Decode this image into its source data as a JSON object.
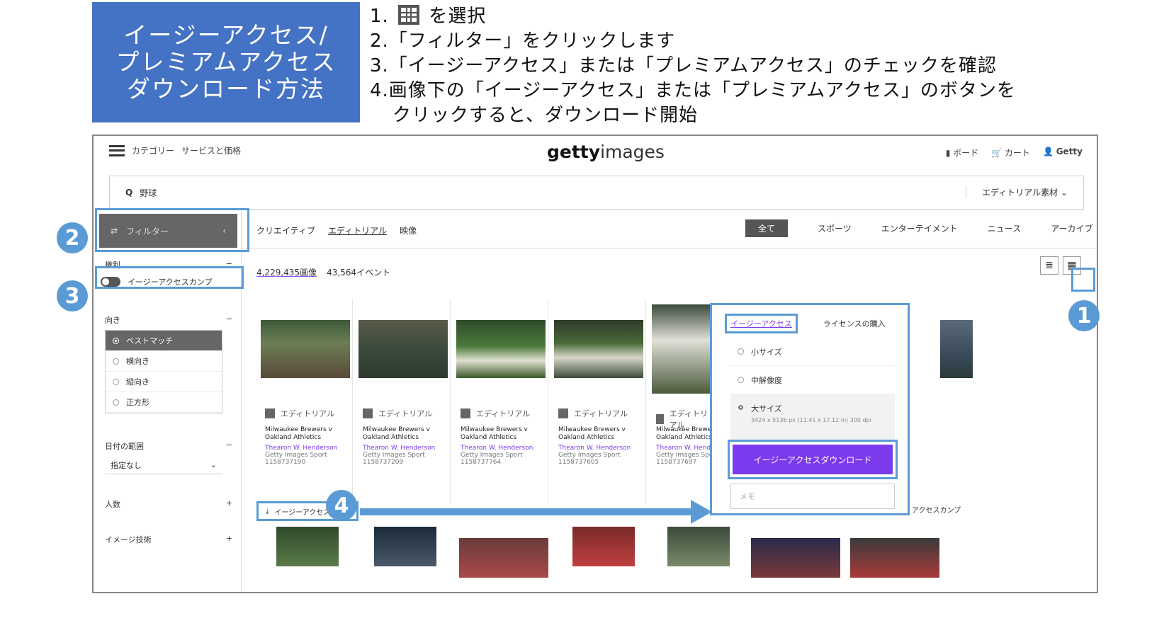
{
  "title_box": {
    "line1": "イージーアクセス/",
    "line2": "プレミアムアクセス",
    "line3": "ダウンロード方法"
  },
  "steps": {
    "s1_prefix": "1.",
    "s1_suffix": "を選択",
    "s2": "2.「フィルター」をクリックします",
    "s3": "3.「イージーアクセス」または「プレミアムアクセス」のチェックを確認",
    "s4": "4.画像下の「イージーアクセス」または「プレミアムアクセス」のボタンを",
    "s4b": "クリックすると、ダウンロード開始"
  },
  "app": {
    "topbar": {
      "categories": "カテゴリー",
      "services": "サービスと価格",
      "logo_bold": "getty",
      "logo_rest": "images",
      "boards": "ボード",
      "cart": "カート",
      "user": "Getty"
    },
    "search": {
      "value": "野球",
      "scope": "エディトリアル素材"
    },
    "filter_button": "フィルター",
    "nav_tabs": [
      "クリエイティブ",
      "エディトリアル",
      "映像"
    ],
    "category_tabs": [
      "全て",
      "スポーツ",
      "エンターテイメント",
      "ニュース",
      "アーカイブ"
    ],
    "sidebar": {
      "license_label": "権利",
      "toggle_label": "イージーアクセスカンプ",
      "orientation_label": "向き",
      "orientation_options": [
        "ベストマッチ",
        "横向き",
        "縦向き",
        "正方形"
      ],
      "date_label": "日付の範囲",
      "date_value": "指定なし",
      "people_label": "人数",
      "image_tech_label": "イメージ技術"
    },
    "results": {
      "images": "4,229,435画像",
      "events": "43,564イベント"
    },
    "cards": [
      {
        "badge": "エディトリアル",
        "title": "Milwaukee Brewers v Oakland Athletics",
        "credit": "Thearon W. Henderson",
        "source": "Getty Images Sport",
        "id": "1158737190"
      },
      {
        "badge": "エディトリアル",
        "title": "Milwaukee Brewers v Oakland Athletics",
        "credit": "Thearon W. Henderson",
        "source": "Getty Images Sport",
        "id": "1158737209"
      },
      {
        "badge": "エディトリアル",
        "title": "Milwaukee Brewers v Oakland Athletics",
        "credit": "Thearon W. Henderson",
        "source": "Getty Images Sport",
        "id": "1158737764"
      },
      {
        "badge": "エディトリアル",
        "title": "Milwaukee Brewers v Oakland Athletics",
        "credit": "Thearon W. Henderson",
        "source": "Getty Images Sport",
        "id": "1158737605"
      },
      {
        "badge": "エディトリアル",
        "title": "Milwaukee Brewers v Oakland Athletics",
        "credit": "Thearon W. Henderson",
        "source": "Getty Images Sport",
        "id": "1158737697"
      }
    ],
    "popup": {
      "tab_active": "イージーアクセス",
      "tab_other": "ライセンスの購入",
      "size_small": "小サイズ",
      "size_medium": "中解像度",
      "size_large": "大サイズ",
      "size_large_detail": "3424 x 5136 px (11.41 x 17.12 in) 300 dpi",
      "download_button": "イージーアクセスダウンロード",
      "memo_placeholder": "メモ"
    },
    "download_row_label": "イージーアクセスカンプ",
    "download_row_right": "アクセスカンプ"
  },
  "callouts": {
    "c1": "1",
    "c2": "2",
    "c3": "3",
    "c4": "4"
  },
  "colors": {
    "callout_blue": "#5b9bd5",
    "title_blue": "#4472c4",
    "purple": "#7c3aed"
  }
}
